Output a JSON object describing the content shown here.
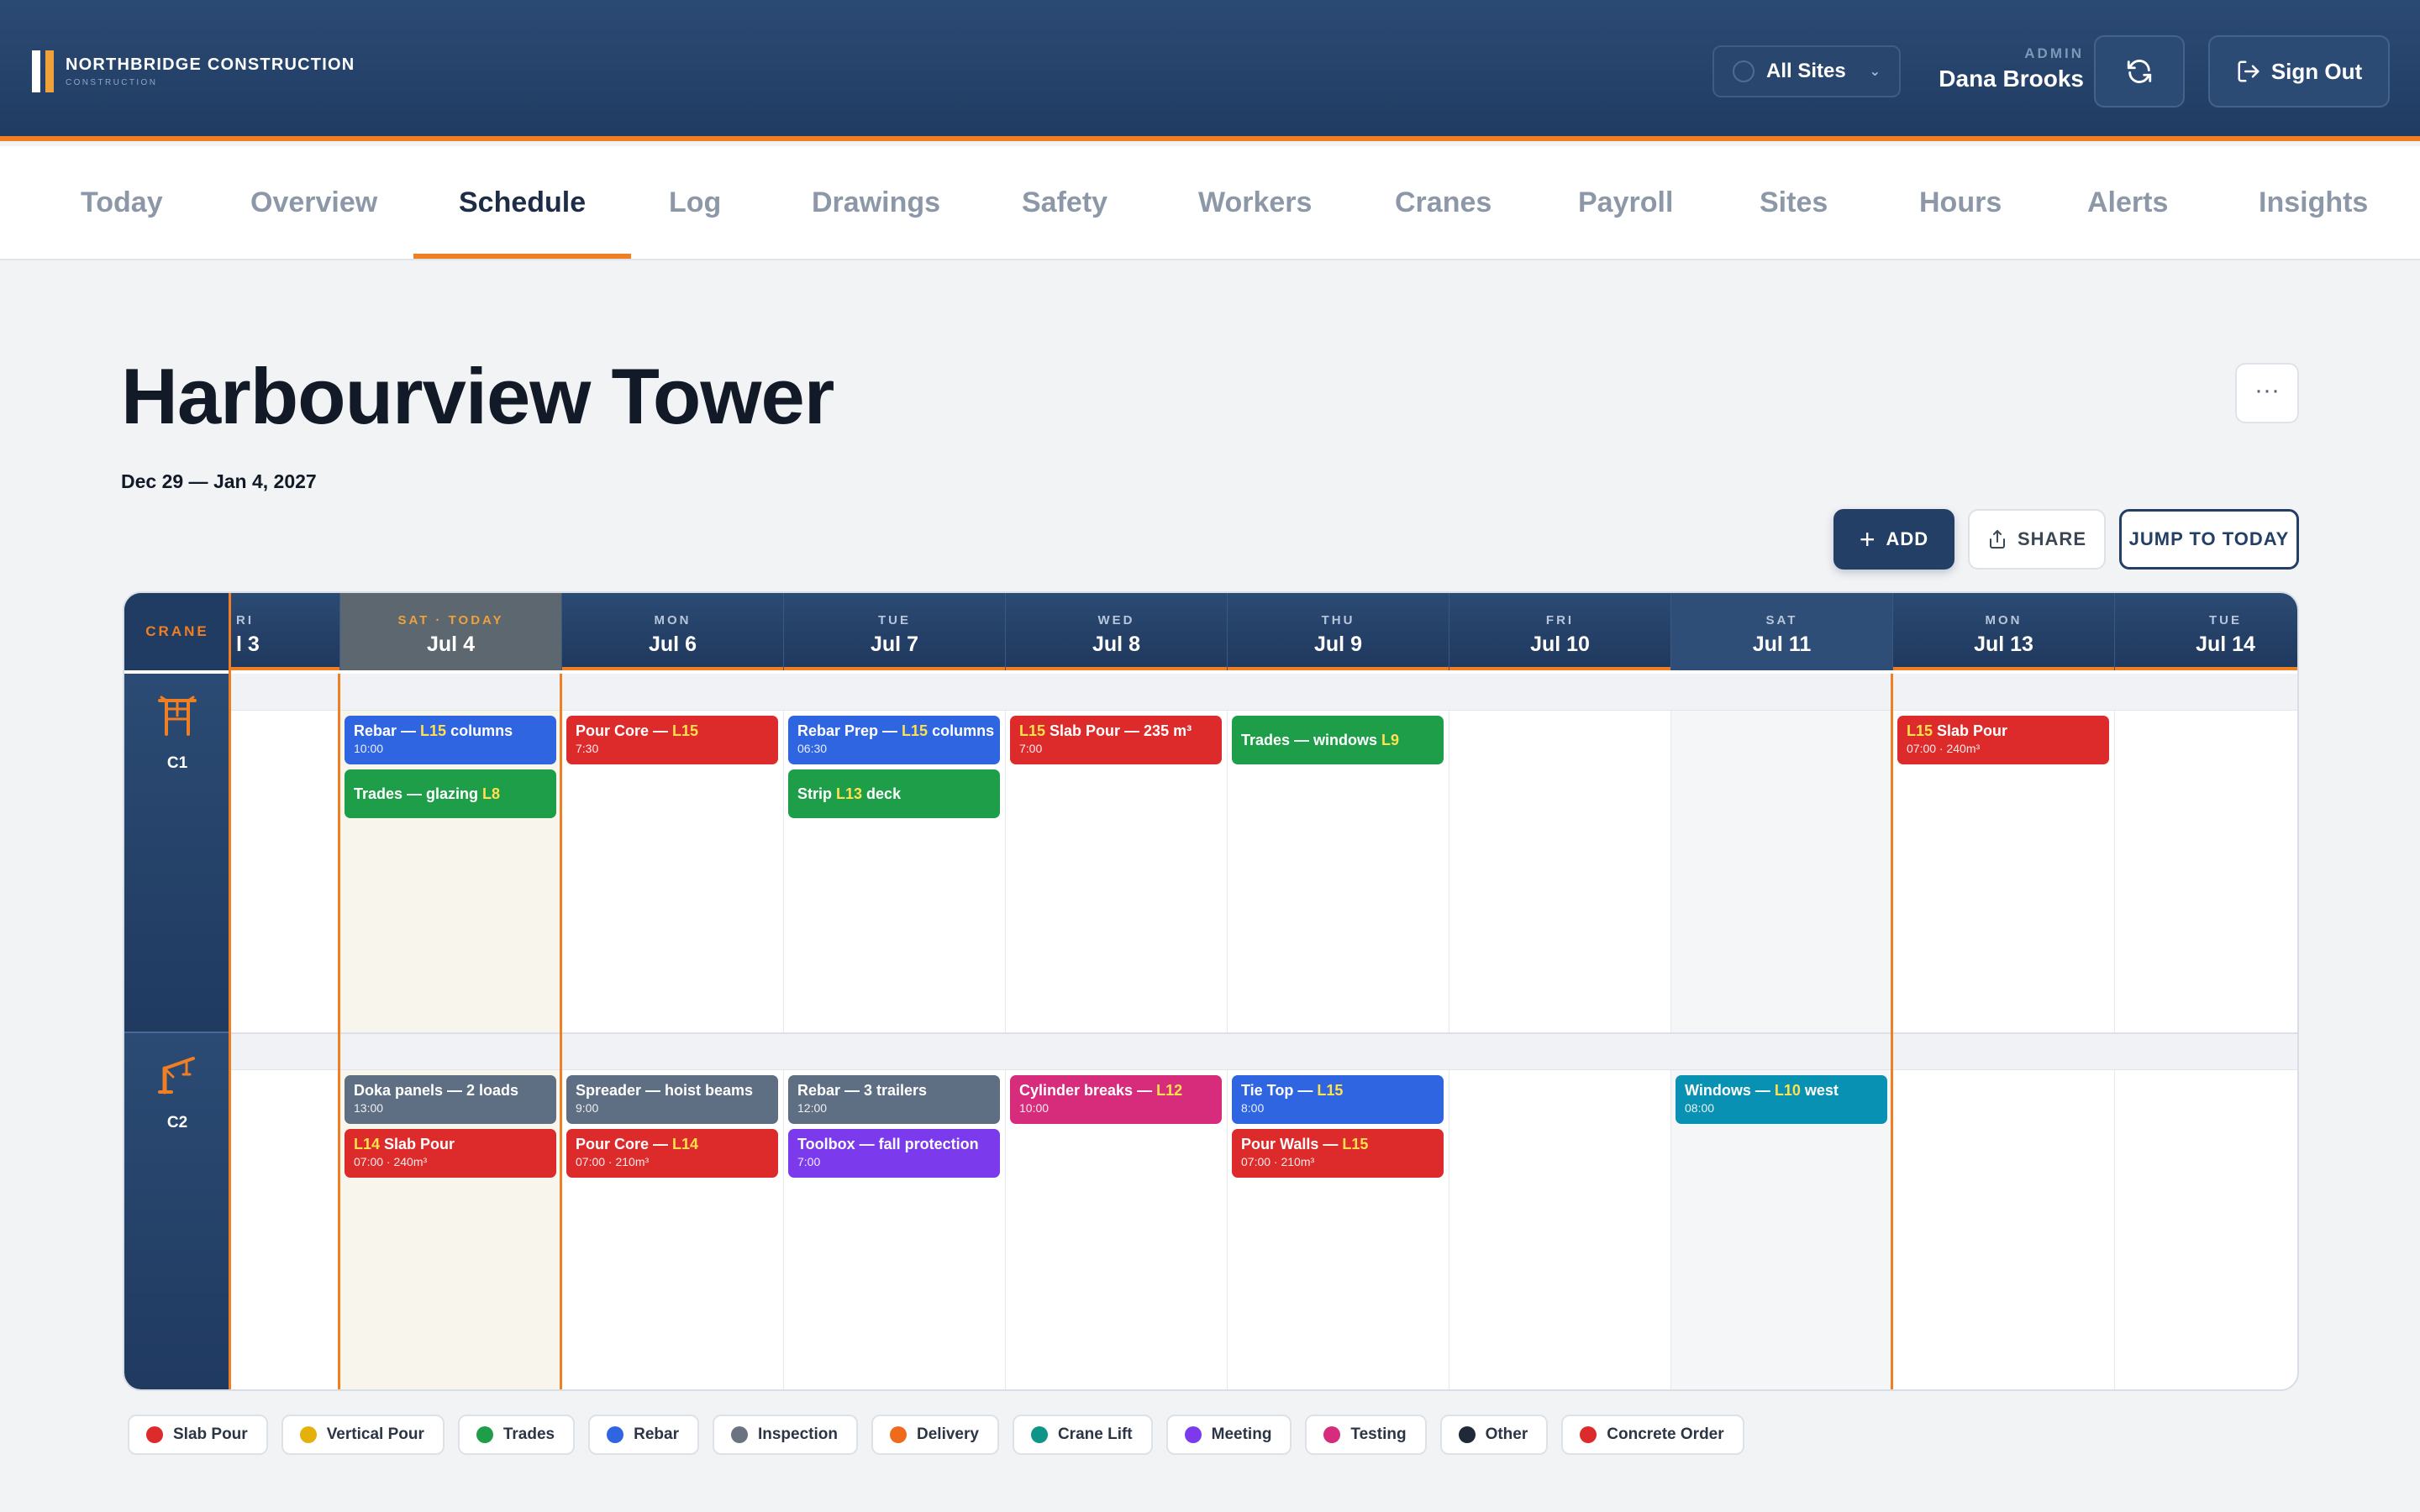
{
  "brand": {
    "name": "NORTHBRIDGE CONSTRUCTION",
    "sub": "CONSTRUCTION"
  },
  "header": {
    "site_select": "All Sites",
    "user_role": "ADMIN",
    "user_name": "Dana Brooks",
    "signout_label": "Sign Out"
  },
  "nav": {
    "tabs": [
      "Today",
      "Overview",
      "Schedule",
      "Log",
      "Drawings",
      "Safety",
      "Workers",
      "Cranes",
      "Payroll",
      "Sites",
      "Hours",
      "Alerts",
      "Insights"
    ],
    "active": "Schedule"
  },
  "page": {
    "title": "Harbourview Tower",
    "date_range": "Dec 29 — Jan 4, 2027",
    "more_label": "···"
  },
  "toolbar": {
    "add_label": "ADD",
    "share_label": "SHARE",
    "jump_label": "JUMP TO TODAY"
  },
  "calendar": {
    "crane_header": "CRANE",
    "days": [
      {
        "dow": "RI",
        "date": "l 3"
      },
      {
        "dow": "SAT · TODAY",
        "date": "Jul 4"
      },
      {
        "dow": "MON",
        "date": "Jul 6"
      },
      {
        "dow": "TUE",
        "date": "Jul 7"
      },
      {
        "dow": "WED",
        "date": "Jul 8"
      },
      {
        "dow": "THU",
        "date": "Jul 9"
      },
      {
        "dow": "FRI",
        "date": "Jul 10"
      },
      {
        "dow": "SAT",
        "date": "Jul 11"
      },
      {
        "dow": "MON",
        "date": "Jul 13"
      },
      {
        "dow": "TUE",
        "date": "Jul 14"
      }
    ],
    "cranes": [
      {
        "label": "C1",
        "events": [
          {
            "day": 1,
            "slot": 0,
            "color": "blue",
            "title": "Rebar — ",
            "hl": "L15",
            "tail": " columns",
            "sub": "10:00"
          },
          {
            "day": 1,
            "slot": 1,
            "color": "green",
            "title": "Trades — glazing ",
            "hl": "L8",
            "tail": "",
            "sub": ""
          },
          {
            "day": 2,
            "slot": 0,
            "color": "red",
            "title": "Pour Core — ",
            "hl": "L15",
            "tail": "",
            "sub": "7:30"
          },
          {
            "day": 3,
            "slot": 0,
            "color": "blue",
            "title": "Rebar Prep — ",
            "hl": "L15",
            "tail": " columns",
            "sub": "06:30"
          },
          {
            "day": 3,
            "slot": 1,
            "color": "green",
            "title": "Strip ",
            "hl": "L13",
            "tail": " deck",
            "sub": ""
          },
          {
            "day": 4,
            "slot": 0,
            "color": "red",
            "title": "",
            "hl": "L15",
            "tail": " Slab Pour — 235 m³",
            "sub": "7:00"
          },
          {
            "day": 5,
            "slot": 0,
            "color": "green",
            "title": "Trades — windows ",
            "hl": "L9",
            "tail": "",
            "sub": ""
          },
          {
            "day": 8,
            "slot": 0,
            "color": "red",
            "title": "",
            "hl": "L15",
            "tail": " Slab Pour",
            "sub": "07:00 · 240m³"
          }
        ]
      },
      {
        "label": "C2",
        "events": [
          {
            "day": 1,
            "slot": 0,
            "color": "gray",
            "title": "Doka panels — 2 loads",
            "hl": "",
            "tail": "",
            "sub": "13:00"
          },
          {
            "day": 1,
            "slot": 1,
            "color": "red",
            "title": "",
            "hl": "L14",
            "tail": " Slab Pour",
            "sub": "07:00 · 240m³"
          },
          {
            "day": 2,
            "slot": 0,
            "color": "gray",
            "title": "Spreader — hoist beams",
            "hl": "",
            "tail": "",
            "sub": "9:00"
          },
          {
            "day": 2,
            "slot": 1,
            "color": "red",
            "title": "Pour Core — ",
            "hl": "L14",
            "tail": "",
            "sub": "07:00 · 210m³"
          },
          {
            "day": 3,
            "slot": 0,
            "color": "gray",
            "title": "Rebar — 3 trailers",
            "hl": "",
            "tail": "",
            "sub": "12:00"
          },
          {
            "day": 3,
            "slot": 1,
            "color": "purple",
            "title": "Toolbox — fall protection",
            "hl": "",
            "tail": "",
            "sub": "7:00"
          },
          {
            "day": 4,
            "slot": 0,
            "color": "pink",
            "title": "Cylinder breaks — ",
            "hl": "L12",
            "tail": "",
            "sub": "10:00"
          },
          {
            "day": 5,
            "slot": 0,
            "color": "blue",
            "title": "Tie Top — ",
            "hl": "L15",
            "tail": "",
            "sub": "8:00"
          },
          {
            "day": 5,
            "slot": 1,
            "color": "red",
            "title": "Pour Walls — ",
            "hl": "L15",
            "tail": "",
            "sub": "07:00 · 210m³"
          },
          {
            "day": 7,
            "slot": 0,
            "color": "teal",
            "title": "Windows — ",
            "hl": "L10",
            "tail": " west",
            "sub": "08:00"
          }
        ]
      }
    ]
  },
  "legend": [
    {
      "label": "Slab Pour",
      "color": "#dd2b2b"
    },
    {
      "label": "Vertical Pour",
      "color": "#e6b00a"
    },
    {
      "label": "Trades",
      "color": "#1f9e4a"
    },
    {
      "label": "Rebar",
      "color": "#2f65e0"
    },
    {
      "label": "Inspection",
      "color": "#6b7280"
    },
    {
      "label": "Delivery",
      "color": "#ef6a1a"
    },
    {
      "label": "Crane Lift",
      "color": "#0f9488"
    },
    {
      "label": "Meeting",
      "color": "#7c3aed"
    },
    {
      "label": "Testing",
      "color": "#d72b7c"
    },
    {
      "label": "Other",
      "color": "#1f2937"
    },
    {
      "label": "Concrete Order",
      "color": "#dd2b2b"
    }
  ],
  "colors": {
    "accent": "#f07f24",
    "primary": "#233f66"
  }
}
